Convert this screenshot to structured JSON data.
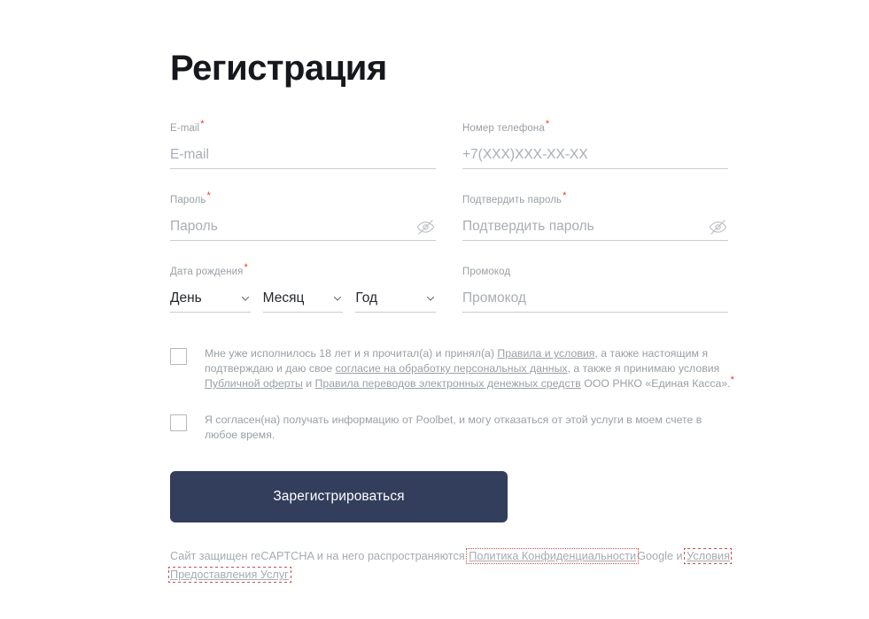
{
  "page": {
    "title": "Регистрация"
  },
  "fields": {
    "email": {
      "label": "E-mail",
      "required": true,
      "placeholder": "E-mail",
      "value": ""
    },
    "phone": {
      "label": "Номер телефона",
      "required": true,
      "placeholder": "+7(XXX)XXX-XX-XX",
      "value": ""
    },
    "password": {
      "label": "Пароль",
      "required": true,
      "placeholder": "Пароль",
      "value": "",
      "toggle_icon": "eye-slash-icon"
    },
    "confirm_password": {
      "label": "Подтвердить пароль",
      "required": true,
      "placeholder": "Подтвердить пароль",
      "value": "",
      "toggle_icon": "eye-slash-icon"
    },
    "birth_date": {
      "label": "Дата рождения",
      "required": true,
      "day": {
        "selected": "День",
        "icon": "chevron-down-icon"
      },
      "month": {
        "selected": "Месяц",
        "icon": "chevron-down-icon"
      },
      "year": {
        "selected": "Год",
        "icon": "chevron-down-icon"
      }
    },
    "promo": {
      "label": "Промокод",
      "required": false,
      "placeholder": "Промокод",
      "value": ""
    }
  },
  "agreements": {
    "terms": {
      "checked": false,
      "part1": "Мне уже исполнилось 18 лет и я прочитал(а) и принял(а) ",
      "link1": "Правила и условия",
      "part2": ", а также настоящим я подтверждаю и даю свое ",
      "link2": "согласие на обработку персональных данных",
      "part3": ", а также я принимаю условия ",
      "link3": "Публичной оферты",
      "part4": " и ",
      "link4": "Правила переводов электронных денежных средств",
      "part5": " ООО РНКО «Единая Касса».",
      "star": "*"
    },
    "marketing": {
      "checked": false,
      "text": "Я согласен(на) получать информацию от Poolbet, и могу отказаться от этой услуги в моем счете в любое время."
    }
  },
  "submit": {
    "label": "Зарегистрироваться"
  },
  "recaptcha": {
    "part1": "Сайт защищен reCAPTCHA и на него распространяются ",
    "link_privacy": "Политика Конфиденциальности",
    "part2": "Google и ",
    "link_terms": "Условия Предоставления Услуг"
  },
  "colors": {
    "accent_button": "#333d5c",
    "required_star": "#e8352e",
    "muted_text": "#9aa0a6",
    "link_outline": "#d14b4b"
  }
}
